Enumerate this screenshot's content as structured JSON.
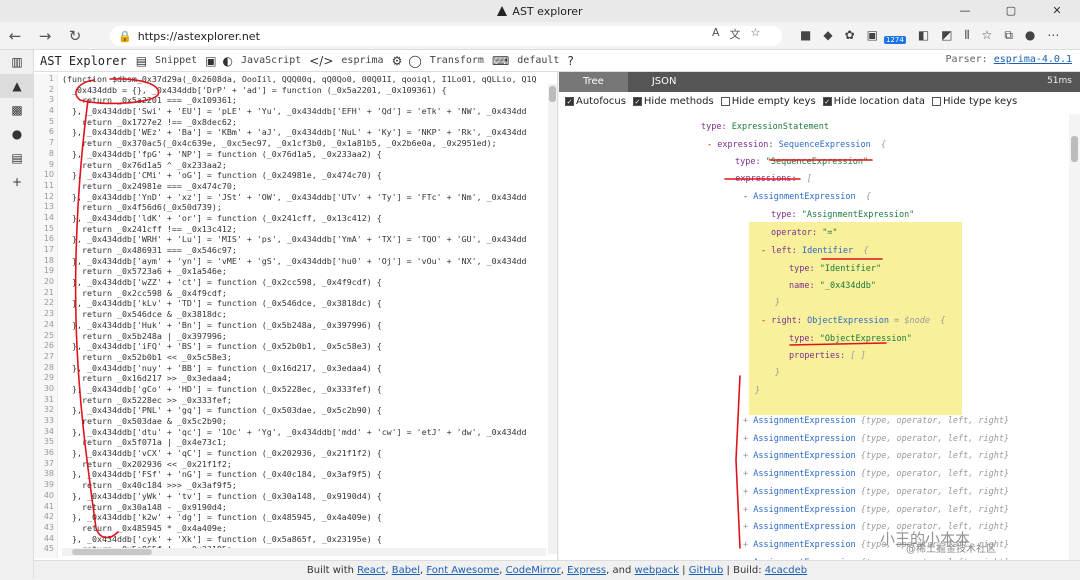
{
  "window": {
    "title": "AST explorer"
  },
  "browser": {
    "url": "https://astexplorer.net",
    "badge_count": "1274"
  },
  "toolbar": {
    "brand": "AST Explorer",
    "snippet": "Snippet",
    "language": "JavaScript",
    "parser": "esprima",
    "transform": "Transform",
    "default": "default",
    "help": "?",
    "parser_label": "Parser:",
    "parser_version": "esprima-4.0.1"
  },
  "panel": {
    "tab_tree": "Tree",
    "tab_json": "JSON",
    "time": "51ms"
  },
  "options": [
    {
      "label": "Autofocus",
      "checked": true
    },
    {
      "label": "Hide methods",
      "checked": true
    },
    {
      "label": "Hide empty keys",
      "checked": false
    },
    {
      "label": "Hide location data",
      "checked": true
    },
    {
      "label": "Hide type keys",
      "checked": false
    }
  ],
  "editor": {
    "lines": [
      "(function $dbsm_0x37d29a(_0x2608da, OooIil, QQQ00q, qQ0Qo0, 00Q01I, qooiql, I1Lo01, qQLLio, Q1Q",
      "  _0x434ddb = {}, _0x434ddb['DrP' + 'ad'] = function (_0x5a2201, _0x109361) {",
      "    return _0x5a2201 === _0x109361;",
      "  }, _0x434ddb['Swi' + 'EU'] = 'pLE' + 'Yu', _0x434ddb['EFH' + 'Qd'] = 'eTk' + 'NW', _0x434dd",
      "    return _0x1727e2 !== _0x8dec62;",
      "  }, _0x434ddb['WEz' + 'Ba'] = 'KBm' + 'aJ', _0x434ddb['NuL' + 'Ky'] = 'NKP' + 'Rk', _0x434dd",
      "    return _0x370ac5(_0x4c639e, _0xc5ec97, _0x1cf3b0, _0x1a81b5, _0x2b6e0a, _0x2951ed);",
      "  }, _0x434ddb['fpG' + 'NP'] = function (_0x76d1a5, _0x233aa2) {",
      "    return _0x76d1a5 ^ _0x233aa2;",
      "  }, _0x434ddb['CMi' + 'oG'] = function (_0x24981e, _0x474c70) {",
      "    return _0x24981e === _0x474c70;",
      "  }, _0x434ddb['YnD' + 'xz'] = 'JSt' + 'OW', _0x434ddb['UTv' + 'Ty'] = 'FTc' + 'Nm', _0x434dd",
      "    return _0x4f56d6(_0x50d739);",
      "  }, _0x434ddb['ldK' + 'or'] = function (_0x241cff, _0x13c412) {",
      "    return _0x241cff !== _0x13c412;",
      "  }, _0x434ddb['WRH' + 'Lu'] = 'MIS' + 'ps', _0x434ddb['YmA' + 'TX'] = 'TQO' + 'GU', _0x434dd",
      "    return _0x486931 === _0x546c97;",
      "  }, _0x434ddb['aym' + 'yn'] = 'vME' + 'gS', _0x434ddb['hu0' + 'Oj'] = 'vOu' + 'NX', _0x434dd",
      "    return _0x5723a6 + _0x1a546e;",
      "  }, _0x434ddb['wZZ' + 'ct'] = function (_0x2cc598, _0x4f9cdf) {",
      "    return _0x2cc598 & _0x4f9cdf;",
      "  }, _0x434ddb['kLv' + 'TD'] = function (_0x546dce, _0x3818dc) {",
      "    return _0x546dce & _0x3818dc;",
      "  }, _0x434ddb['Huk' + 'Bn'] = function (_0x5b248a, _0x397996) {",
      "    return _0x5b248a | _0x397996;",
      "  }, _0x434ddb['iFQ' + 'BS'] = function (_0x52b0b1, _0x5c58e3) {",
      "    return _0x52b0b1 << _0x5c58e3;",
      "  }, _0x434ddb['nuy' + 'BB'] = function (_0x16d217, _0x3edaa4) {",
      "    return _0x16d217 >> _0x3edaa4;",
      "  }, _0x434ddb['gCo' + 'HD'] = function (_0x5228ec, _0x333fef) {",
      "    return _0x5228ec >> _0x333fef;",
      "  }, _0x434ddb['PNL' + 'gq'] = function (_0x503dae, _0x5c2b90) {",
      "    return _0x503dae & _0x5c2b90;",
      "  }, _0x434ddb['dtu' + 'qc'] = '1Oc' + 'Yg', _0x434ddb['mdd' + 'cw'] = 'etJ' + 'dw', _0x434dd",
      "    return _0x5f071a | _0x4e73c1;",
      "  }, _0x434ddb['vCX' + 'qC'] = function (_0x202936, _0x21f1f2) {",
      "    return _0x202936 << _0x21f1f2;",
      "  }, _0x434ddb['FSf' + 'nG'] = function (_0x40c184, _0x3af9f5) {",
      "    return _0x40c184 >>> _0x3af9f5;",
      "  }, _0x434ddb['yWk' + 'tv'] = function (_0x30a148, _0x9190d4) {",
      "    return _0x30a148 - _0x9190d4;",
      "  }, _0x434ddb['k2w' + 'dg'] = function (_0x485945, _0x4a409e) {",
      "    return _0x485945 * _0x4a409e;",
      "  }, _0x434ddb['cyk' + 'Xk'] = function (_0x5a865f, _0x23195e) {",
      "    return _0x5a865f !== _0x23195e;"
    ]
  },
  "tree": {
    "top_type": "ExpressionStatement",
    "expr_key": "expression:",
    "expr_type": "SequenceExpression",
    "type_key": "type:",
    "type_seq": "\"SequenceExpression\"",
    "exprs_key": "expressions:",
    "bracket": "[",
    "assign": "AssignmentExpression",
    "brace": "{",
    "assign_type": "\"AssignmentExpression\"",
    "operator_key": "operator:",
    "operator_val": "\"=\"",
    "left_key": "left:",
    "left_type": "Identifier",
    "left_type_val": "\"Identifier\"",
    "name_key": "name:",
    "name_val": "\"_0x434ddb\"",
    "right_key": "right:",
    "right_type": "ObjectExpression",
    "right_meta": "= $node",
    "right_type_val": "\"ObjectExpression\"",
    "props_key": "properties:",
    "props_val": "[ ]",
    "close_brace": "}",
    "collapsed_label": "AssignmentExpression",
    "collapsed_meta": "{type, operator, left, right}",
    "collapsed_count": 11
  },
  "footer": {
    "built_with": "Built with",
    "links": [
      "React",
      "Babel",
      "Font Awesome",
      "CodeMirror",
      "Express",
      "webpack",
      "GitHub"
    ],
    "and": ", and",
    "build": "| Build:",
    "build_id": "4cacdeb"
  },
  "watermark": {
    "title": "小王的小本本",
    "subtitle": "@稀土掘金技术社区"
  },
  "colors": {
    "annotation": "#e0131b",
    "highlight": "#f8f09a",
    "link": "#1a5fb4"
  }
}
